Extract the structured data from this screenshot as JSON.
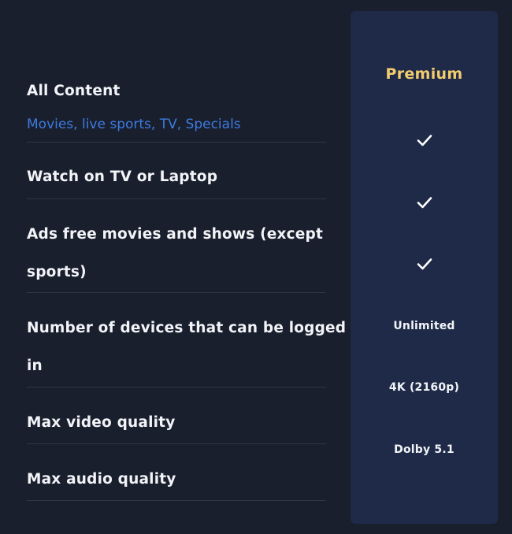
{
  "plan": {
    "name": "Premium",
    "accent_color": "#f3cc6d"
  },
  "features": [
    {
      "title": "All Content",
      "subtitle": "Movies, live sports, TV, Specials",
      "value_icon": "check-icon"
    },
    {
      "title": "Watch on TV or Laptop",
      "value_icon": "check-icon"
    },
    {
      "title_line1": "Ads free movies and shows (except",
      "title_line2": "sports)",
      "value_icon": "check-icon"
    },
    {
      "title_line1": "Number of devices that can be logged",
      "title_line2": "in",
      "value": "Unlimited"
    },
    {
      "title": "Max video quality",
      "value": "4K (2160p)"
    },
    {
      "title": "Max audio quality",
      "value": "Dolby 5.1"
    }
  ],
  "colors": {
    "background": "#1a1f2e",
    "plan_column": "#1e2a48",
    "subtitle_link": "#3d7be0",
    "divider": "#2f3646"
  }
}
